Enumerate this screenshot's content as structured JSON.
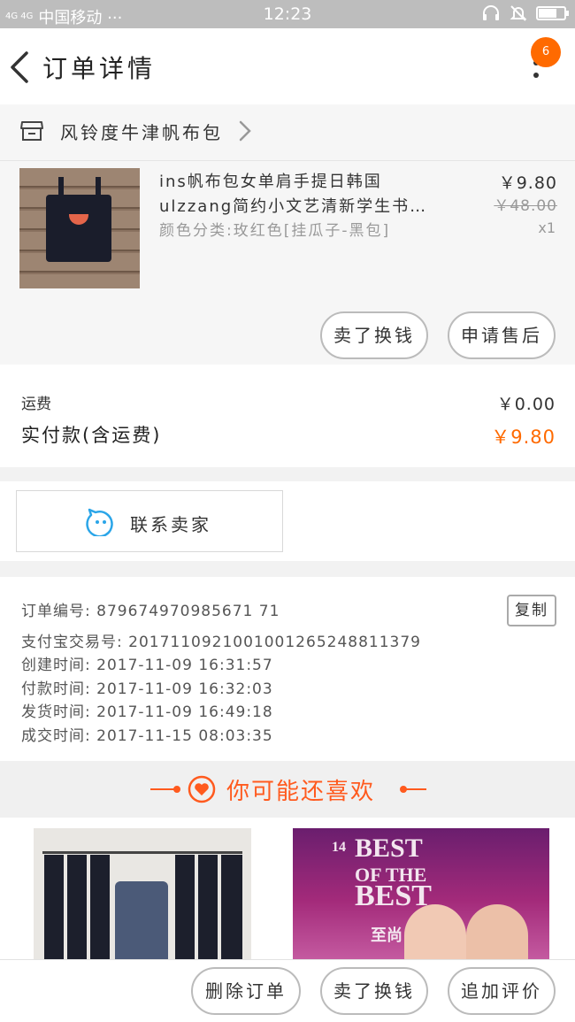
{
  "status_bar": {
    "network": "4G 4G",
    "carrier": "中国移动 ···",
    "time": "12:23",
    "battery_level": 0.7
  },
  "nav": {
    "title": "订单详情",
    "badge": "6",
    "icons": [
      "back-icon",
      "more-icon"
    ]
  },
  "shop": {
    "name": "风铃度牛津帆布包",
    "icon": "store-icon"
  },
  "item": {
    "title_line1": "ins帆布包女单肩手提日韩国",
    "title_line2": "ulzzang简约小文艺清新学生书…",
    "sku": "颜色分类:玫红色[挂瓜子-黑包]",
    "price": "￥9.80",
    "original_price": "￥48.00",
    "quantity": "x1",
    "buttons": {
      "refund": "卖了换钱",
      "after_sale": "申请售后"
    }
  },
  "cost": {
    "shipping_label": "运费",
    "shipping_value": "￥0.00",
    "paid_label": "实付款(含运费)",
    "paid_value": "￥9.80",
    "accent_color": "#ff6a00"
  },
  "contact": {
    "label": "联系卖家"
  },
  "order_info": {
    "lines": [
      "订单编号: 879674970985671 71",
      "支付宝交易号: 2017110921001001265248811379",
      "创建时间: 2017-11-09  16:31:57",
      "付款时间: 2017-11-09  16:32:03",
      "发货时间: 2017-11-09  16:49:18",
      "成交时间: 2017-11-15  08:03:35"
    ],
    "copy_label": "复制"
  },
  "recommend": {
    "title": "你可能还喜欢",
    "banner_line1": "BEST",
    "banner_line2": "OF THE",
    "banner_line3": "BEST",
    "banner_small": "14",
    "banner_sub": "至尚"
  },
  "bottom_bar": {
    "delete": "删除订单",
    "refund": "卖了换钱",
    "review": "追加评价"
  }
}
